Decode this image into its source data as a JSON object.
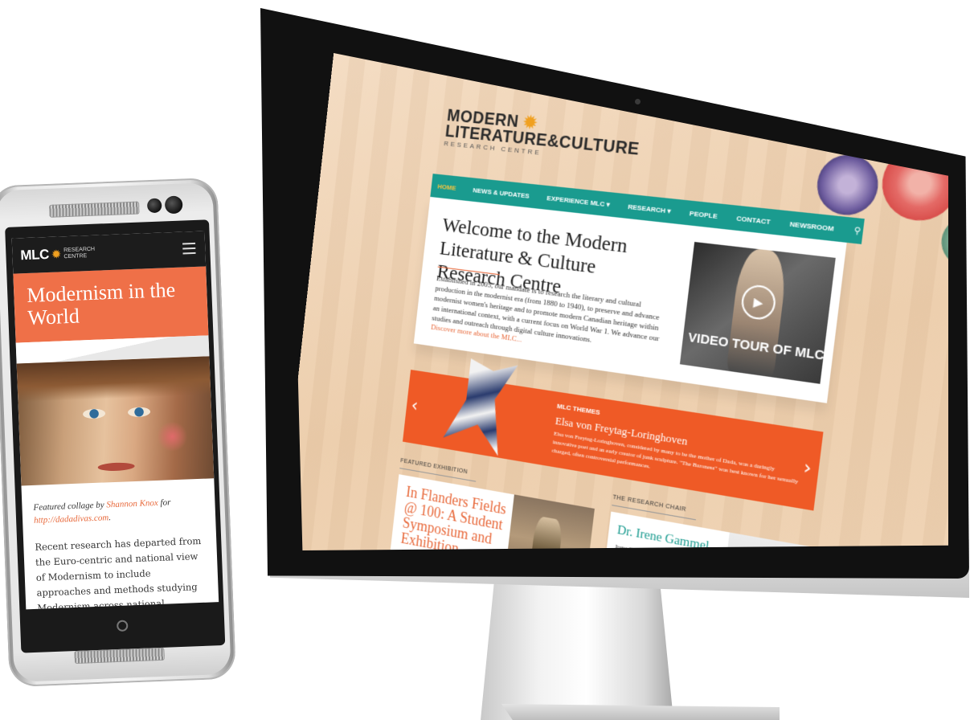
{
  "phone": {
    "logo": "MLC",
    "logo_sub_1": "RESEARCH",
    "logo_sub_2": "CENTRE",
    "hero_title": "Modernism in the World",
    "caption_prefix": "Featured collage by ",
    "caption_artist": "Shannon Knox",
    "caption_mid": " for ",
    "caption_link": "http://dadadivas.com",
    "caption_end": ".",
    "body": "Recent research has departed from the Euro-centric and national view of Modernism to include approaches and methods studying Modernism across national boundaries and across different art forms to include fashion, dance, performance, technology"
  },
  "desktop": {
    "logo": {
      "line1": "MODERN",
      "line2": "LITERATURE&CULTURE",
      "line3": "RESEARCH CENTRE"
    },
    "nav": [
      "HOME",
      "NEWS & UPDATES",
      "EXPERIENCE MLC ▾",
      "RESEARCH ▾",
      "PEOPLE",
      "CONTACT",
      "NEWSROOM"
    ],
    "welcome_title": "Welcome to the Modern Literature & Culture Research Centre",
    "intro": "Established in 2005, our mandate is to research the literary and cultural production in the modernist era (from 1880 to 1940), to preserve and advance modernist women's heritage and to promote modern Canadian heritage within an international context, with a current focus on World War 1. We advance our studies and outreach through digital culture innovations.",
    "discover_link": "Discover more about the MLC...",
    "video_label": "VIDEO TOUR OF MLC",
    "themes": {
      "kicker": "MLC THEMES",
      "title": "Elsa von Freytag-Loringhoven",
      "text": "Elsa von Freytag-Loringhoven, considered by many to be the mother of Dada, was a daringly innovative poet and an early creator of junk sculpture. \"The Baroness\" was best known for her sexually charged, often controversial performances."
    },
    "featured": {
      "label": "FEATURED EXHIBITION",
      "title": "In Flanders Fields @ 100: A Student Symposium and Exhibition"
    },
    "chair": {
      "label": "THE RESEARCH CHAIR",
      "name": "Dr. Irene Gammel",
      "text": "Irene Gammel is the author and editor of thirteen books including Baroness Elsa - A Cultural Biography, and is currently embarked on a study"
    }
  },
  "colors": {
    "accent_orange": "#ef5a26",
    "teal_nav": "#1a9b8f",
    "hero_orange": "#ef7048"
  }
}
